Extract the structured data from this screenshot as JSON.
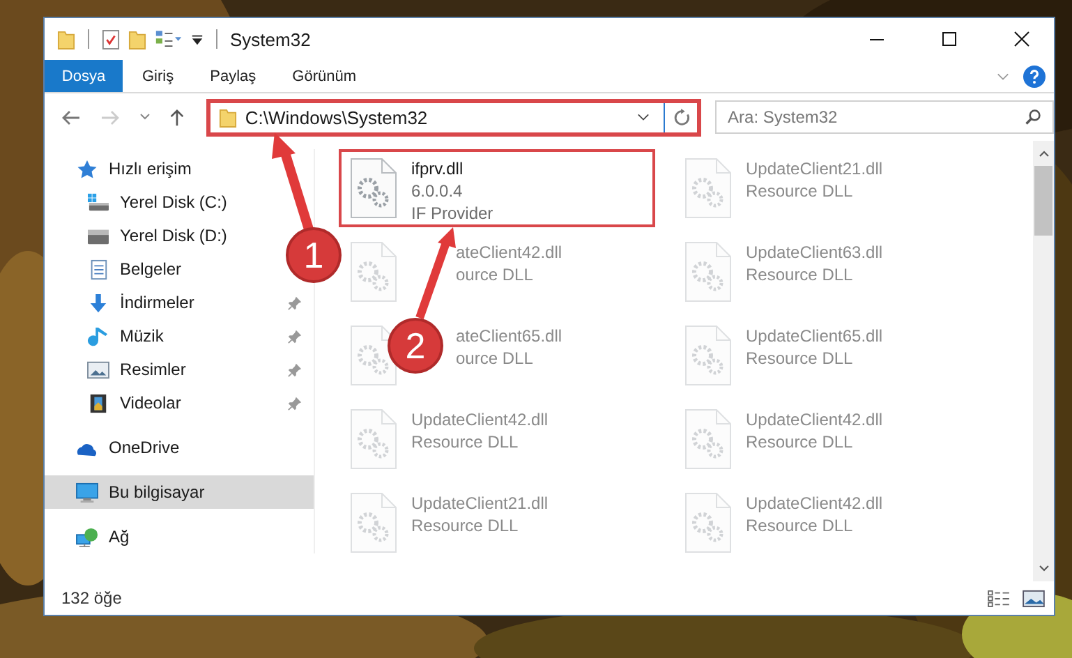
{
  "window": {
    "title": "System32"
  },
  "ribbon": {
    "tabs": [
      {
        "label": "Dosya",
        "kind": "file"
      },
      {
        "label": "Giriş",
        "kind": "tab"
      },
      {
        "label": "Paylaş",
        "kind": "tab"
      },
      {
        "label": "Görünüm",
        "kind": "tab"
      }
    ]
  },
  "address": {
    "path": "C:\\Windows\\System32",
    "highlighted": true
  },
  "search": {
    "placeholder": "Ara: System32"
  },
  "sidebar": {
    "items": [
      {
        "label": "Hızlı erişim",
        "kind": "quick-access",
        "selected": false,
        "children": [
          {
            "label": "Yerel Disk (C:)",
            "kind": "system-drive",
            "selected": false,
            "pinned": false
          },
          {
            "label": "Yerel Disk (D:)",
            "kind": "drive",
            "selected": false,
            "pinned": false
          },
          {
            "label": "Belgeler",
            "kind": "documents",
            "selected": false,
            "pinned": false
          },
          {
            "label": "İndirmeler",
            "kind": "downloads",
            "selected": false,
            "pinned": true
          },
          {
            "label": "Müzik",
            "kind": "music",
            "selected": false,
            "pinned": true
          },
          {
            "label": "Resimler",
            "kind": "pictures",
            "selected": false,
            "pinned": true
          },
          {
            "label": "Videolar",
            "kind": "videos",
            "selected": false,
            "pinned": true
          }
        ]
      },
      {
        "label": "OneDrive",
        "kind": "cloud",
        "selected": false
      },
      {
        "label": "Bu bilgisayar",
        "kind": "computer",
        "selected": true
      },
      {
        "label": "Ağ",
        "kind": "network",
        "selected": false
      }
    ]
  },
  "files": [
    {
      "name": "ifprv.dll",
      "details": [
        "6.0.0.4",
        "IF Provider"
      ],
      "highlighted": true,
      "dimmed": false
    },
    {
      "name": "UpdateClient21.dll",
      "details": [
        "Resource DLL"
      ],
      "highlighted": false,
      "dimmed": true
    },
    {
      "name": "ateClient42.dll",
      "details": [
        "ource DLL"
      ],
      "highlighted": false,
      "dimmed": true,
      "kind": "covered"
    },
    {
      "name": "UpdateClient63.dll",
      "details": [
        "Resource DLL"
      ],
      "highlighted": false,
      "dimmed": true
    },
    {
      "name": "ateClient65.dll",
      "details": [
        "ource DLL"
      ],
      "highlighted": false,
      "dimmed": true,
      "kind": "covered"
    },
    {
      "name": "UpdateClient65.dll",
      "details": [
        "Resource DLL"
      ],
      "highlighted": false,
      "dimmed": true
    },
    {
      "name": "UpdateClient42.dll",
      "details": [
        "Resource DLL"
      ],
      "highlighted": false,
      "dimmed": true
    },
    {
      "name": "UpdateClient42.dll",
      "details": [
        "Resource DLL"
      ],
      "highlighted": false,
      "dimmed": true
    },
    {
      "name": "UpdateClient21.dll",
      "details": [
        "Resource DLL"
      ],
      "highlighted": false,
      "dimmed": true
    },
    {
      "name": "UpdateClient42.dll",
      "details": [
        "Resource DLL"
      ],
      "highlighted": false,
      "dimmed": true
    }
  ],
  "status_bar": {
    "count": "132 öğe"
  },
  "annotations": [
    {
      "label": "1"
    },
    {
      "label": "2"
    }
  ]
}
